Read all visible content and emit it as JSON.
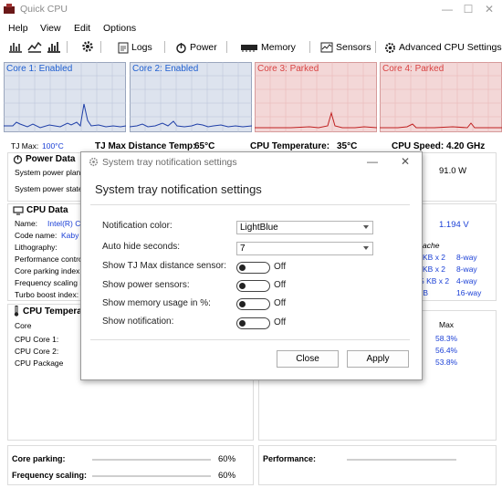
{
  "window": {
    "title": "Quick CPU"
  },
  "menu": [
    "Help",
    "View",
    "Edit",
    "Options"
  ],
  "toolbar": {
    "logs": "Logs",
    "power": "Power",
    "memory": "Memory",
    "sensors": "Sensors",
    "advanced": "Advanced CPU Settings"
  },
  "cores": [
    {
      "label": "Core 1: Enabled",
      "color": "#1f5fd0"
    },
    {
      "label": "Core 2: Enabled",
      "color": "#1f5fd0"
    },
    {
      "label": "Core 3: Parked",
      "color": "#d94343"
    },
    {
      "label": "Core 4: Parked",
      "color": "#d94343"
    }
  ],
  "stats": {
    "tjmax_label": "TJ Max:",
    "tjmax_value": "100°C",
    "tjdist_label": "TJ Max Distance Temp:",
    "tjdist_value": "65°C",
    "cputemp_label": "CPU Temperature:",
    "cputemp_value": "35°C",
    "cpuspeed_label": "CPU Speed:",
    "cpuspeed_value": "4.20 GHz"
  },
  "power": {
    "title": "Power Data",
    "lines": [
      "System power plan:",
      "System power state:"
    ],
    "value": "91.0 W"
  },
  "cpudata": {
    "title": "CPU Data",
    "lines": [
      "Name:",
      "Code name:",
      "Lithography:",
      "Performance control",
      "Core parking index:",
      "Frequency scaling in",
      "Turbo boost index:"
    ],
    "name_value": "Intel(R) Co",
    "codename_value": "Kaby",
    "voltage": "1.194 V",
    "cache_header": "ache",
    "cache_rows": [
      {
        "size": "KB x 2",
        "way": "8-way"
      },
      {
        "size": "KB x 2",
        "way": "8-way"
      },
      {
        "size": "5 KB x 2",
        "way": "4-way"
      },
      {
        "size": "IB",
        "way": "16-way"
      }
    ]
  },
  "temps": {
    "title": "CPU Tempera",
    "col": "Core",
    "rows": [
      "CPU Core 1:",
      "CPU Core 2:",
      "CPU Package"
    ],
    "max_header": "Max",
    "max_values": [
      "58.3%",
      "56.4%",
      "53.8%"
    ]
  },
  "bottom": {
    "parking_label": "Core parking:",
    "parking_value": "60%",
    "freq_label": "Frequency scaling:",
    "freq_value": "60%",
    "perf_label": "Performance:"
  },
  "dialog": {
    "title": "System tray notification settings",
    "heading": "System tray notification settings",
    "color_label": "Notification color:",
    "color_value": "LightBlue",
    "hide_label": "Auto hide seconds:",
    "hide_value": "7",
    "toggles": [
      {
        "label": "Show TJ Max distance sensor:",
        "state": "Off"
      },
      {
        "label": "Show power sensors:",
        "state": "Off"
      },
      {
        "label": "Show memory usage in %:",
        "state": "Off"
      },
      {
        "label": "Show notification:",
        "state": "Off"
      }
    ],
    "close_label": "Close",
    "apply_label": "Apply"
  }
}
